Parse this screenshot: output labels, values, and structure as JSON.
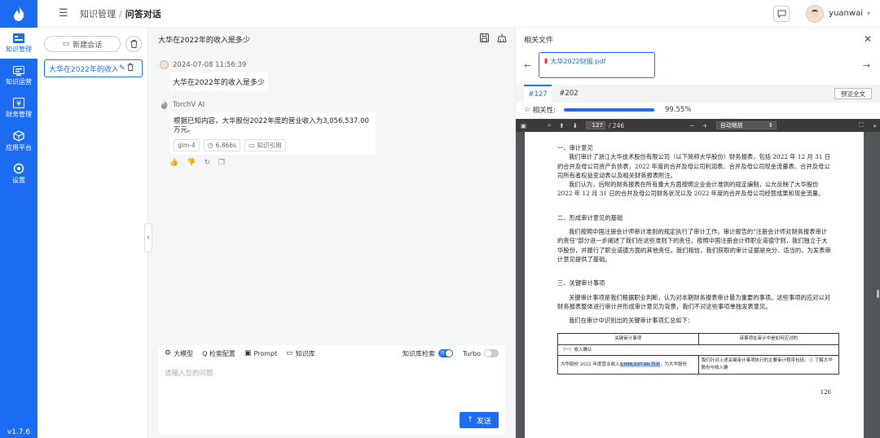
{
  "app": {
    "version": "v1.7.6"
  },
  "nav": [
    {
      "label": "知识管理",
      "icon": "knowledge-icon"
    },
    {
      "label": "知识运营",
      "icon": "operation-icon"
    },
    {
      "label": "财务管理",
      "icon": "finance-icon"
    },
    {
      "label": "应用平台",
      "icon": "app-platform-icon"
    },
    {
      "label": "设置",
      "icon": "settings-icon"
    }
  ],
  "header": {
    "breadcrumb_parent": "知识管理",
    "breadcrumb_sep": "/",
    "breadcrumb_current": "问答对话",
    "username": "yuanwai"
  },
  "conversations": {
    "new_label": "新建会话",
    "items": [
      {
        "title": "大华在2022年的收入是多少"
      }
    ]
  },
  "chat": {
    "title": "大华在2022年的收入是多少",
    "user_msg": {
      "time": "2024-07-08 11:56:39",
      "text": "大华在2022年的收入是多少"
    },
    "ai_msg": {
      "name": "TorchV AI",
      "text": "根据已知内容，大华股份2022年度的营业收入为3,056,537.00万元。",
      "model": "glm-4",
      "duration": "6.866s",
      "cite_label": "知识引用"
    }
  },
  "composer": {
    "tools": [
      "大模型",
      "Q 检索配置",
      "Prompt",
      "知识库"
    ],
    "kb_search_label": "知识库检索",
    "kb_search_on": "开",
    "turbo_label": "Turbo",
    "placeholder": "请输入您的问题",
    "send_label": "发送"
  },
  "files": {
    "title": "相关文件",
    "file_name": "大华2022财报.pdf",
    "tabs": [
      "#127",
      "#202"
    ],
    "preview_label": "预览全文",
    "relevance_label": "相关性:",
    "relevance_value": "99.55%",
    "relevance_fraction": 0.9955
  },
  "pdf": {
    "page_current": "127",
    "page_total": "/ 246",
    "zoom": "自动缩放",
    "section1_title": "一、审计意见",
    "section1_p1": "我们审计了浙江大华技术股份有限公司（以下简称大华股份）财务报表，包括 2022 年 12 月 31 日的合并及母公司资产负债表，2022 年度的合并及母公司利润表、合并及母公司现金流量表、合并及母公司所有者权益变动表以及相关财务报表附注。",
    "section1_p2": "我们认为，后附的财务报表在所有重大方面按照企业会计准则的规定编制，公允反映了大华股份 2022 年 12 月 31 日的合并及母公司财务状况以及 2022 年度的合并及母公司经营成果和现金流量。",
    "section2_title": "二、形成审计意见的基础",
    "section2_p1": "我们按照中国注册会计师审计准则的规定执行了审计工作。审计报告的\"注册会计师对财务报表审计的责任\"部分进一步阐述了我们在这些准则下的责任。按照中国注册会计师职业道德守则，我们独立于大华股份，并履行了职业道德方面的其他责任。我们相信，我们获取的审计证据是充分、适当的，为发表审计意见提供了基础。",
    "section3_title": "三、关键审计事项",
    "section3_p1": "关键审计事项是我们根据职业判断，认为对本期财务报表审计最为重要的事项。这些事项的应对以对财务报表整体进行审计并形成审计意见为背景，我们不对这些事项单独发表意见。",
    "section3_p2": "我们在审计中识别出的关键审计事项汇总如下：",
    "table_head1": "关键审计事项",
    "table_head2": "该事项在审计中是如何应对的",
    "table_sub": "（一）收入确认",
    "table_c1_pre": "大华股份 2022 年度营业收入",
    "table_c1_hl": "3,056,537.00 万元",
    "table_c1_post": "，为大华股份",
    "table_c2": "我们针对上述关键审计事项执行的主要审计程序包括：① 了解大华股份与收入确",
    "page_number": "126"
  }
}
